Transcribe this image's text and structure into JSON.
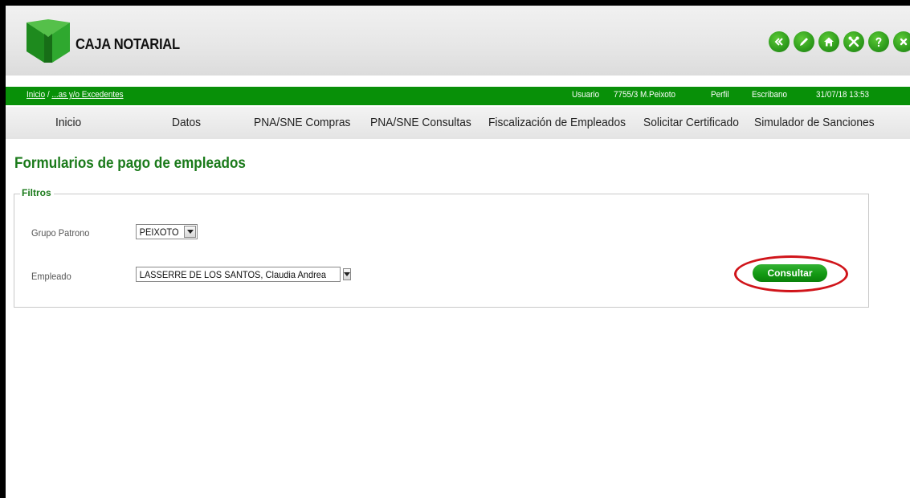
{
  "header": {
    "logo_text": "CAJA NOTARIAL",
    "icons": [
      "back-icon",
      "edit-icon",
      "home-icon",
      "tools-icon",
      "help-icon",
      "close-icon"
    ]
  },
  "status_bar": {
    "breadcrumb_home": "Inicio",
    "breadcrumb_separator": "/",
    "breadcrumb_current": "...as y/o Excedentes",
    "usuario_label": "Usuario",
    "usuario_value": "7755/3 M.Peixoto",
    "perfil_label": "Perfil",
    "perfil_value": "Escribano",
    "datetime": "31/07/18 13:53"
  },
  "nav": {
    "items": [
      "Inicio",
      "Datos",
      "PNA/SNE Compras",
      "PNA/SNE Consultas",
      "Fiscalización de Empleados",
      "Solicitar Certificado",
      "Simulador de Sanciones"
    ]
  },
  "page": {
    "title": "Formularios de pago de empleados"
  },
  "filters": {
    "legend": "Filtros",
    "grupo_patrono_label": "Grupo Patrono",
    "grupo_patrono_value": "PEIXOTO",
    "empleado_label": "Empleado",
    "empleado_value": "LASSERRE DE LOS SANTOS, Claudia Andrea",
    "consultar_label": "Consultar"
  },
  "colors": {
    "brand_green": "#089008",
    "title_green": "#1a7a1a",
    "highlight_red": "#d0141a"
  }
}
